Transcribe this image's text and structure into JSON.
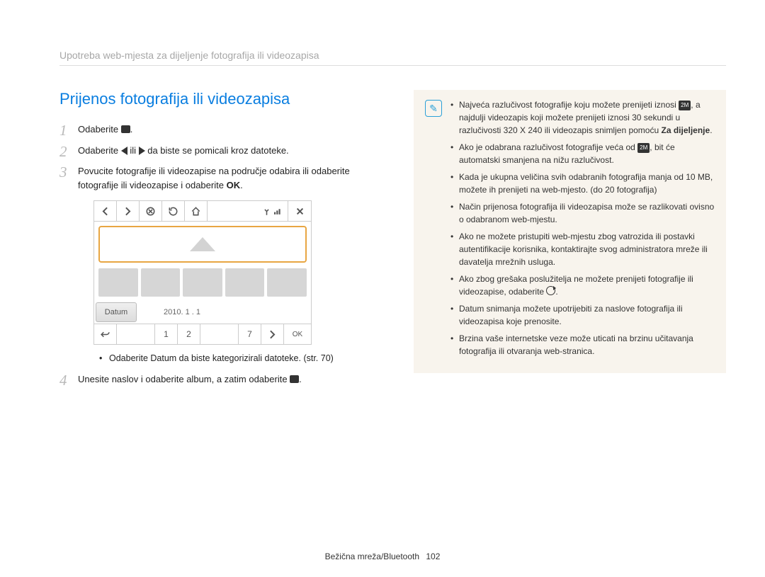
{
  "breadcrumb": "Upotreba web-mjesta za dijeljenje fotografija ili videozapisa",
  "section_title": "Prijenos fotografija ili videozapisa",
  "steps": {
    "s1": "Odaberite ",
    "s2_a": "Odaberite ",
    "s2_b": " ili ",
    "s2_c": " da biste se pomicali kroz datoteke.",
    "s3": "Povucite fotografije ili videozapise na područje odabira ili odaberite fotografije ili videozapise i odaberite ",
    "s3_ok": "OK",
    "s3_end": ".",
    "s4": "Unesite naslov i odaberite album, a zatim odaberite "
  },
  "sub_note": "Odaberite Datum da biste kategorizirali datoteke. (str. 70)",
  "device": {
    "datum_label": "Datum",
    "date_value": "2010. 1 . 1",
    "bottom": {
      "p1": "1",
      "p2": "2",
      "p7": "7",
      "ok": "OK"
    }
  },
  "notice": {
    "n1_a": "Najveća razlučivost fotografije koju možete prenijeti iznosi ",
    "n1_b": ", a najdulji videozapis koji možete prenijeti iznosi 30 sekundi u razlučivosti 320 X 240 ili videozapis snimljen pomoću ",
    "n1_bold": "Za dijeljenje",
    "n1_c": ".",
    "n2_a": "Ako je odabrana razlučivost fotografije veća od ",
    "n2_b": ", bit će automatski smanjena na nižu razlučivost.",
    "n3": "Kada je ukupna veličina svih odabranih fotografija manja od 10 MB, možete ih prenijeti na web-mjesto. (do 20 fotografija)",
    "n4": "Način prijenosa fotografija ili videozapisa može se razlikovati ovisno o odabranom web-mjestu.",
    "n5": "Ako ne možete pristupiti web-mjestu zbog vatrozida ili postavki autentifikacije korisnika, kontaktirajte svog administratora mreže ili davatelja mrežnih usluga.",
    "n6_a": "Ako zbog grešaka poslužitelja ne možete prenijeti fotografije ili videozapise, odaberite ",
    "n6_b": ".",
    "n7": "Datum snimanja možete upotrijebiti za naslove fotografija ili videozapisa koje prenosite.",
    "n8": "Brzina vaše internetske veze može uticati na brzinu učitavanja fotografija ili otvaranja web-stranica."
  },
  "footer": {
    "label": "Bežična mreža/Bluetooth",
    "page": "102"
  }
}
